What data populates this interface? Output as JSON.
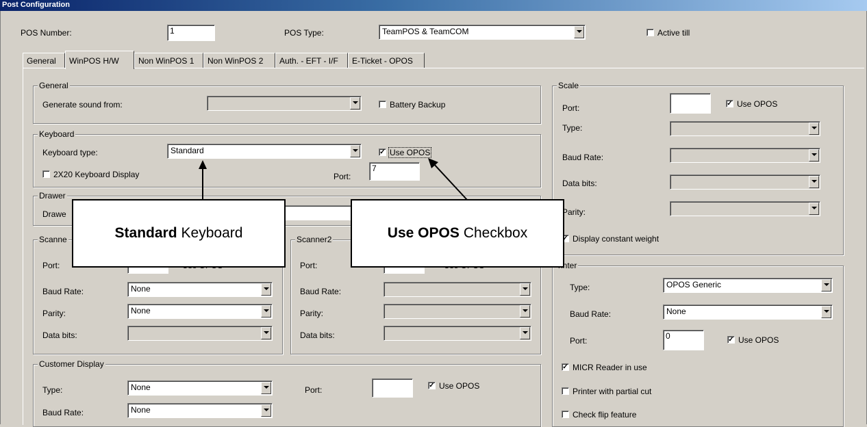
{
  "window": {
    "title": "Post Configuration"
  },
  "header": {
    "pos_number_label": "POS Number:",
    "pos_number_value": "1",
    "pos_type_label": "POS Type:",
    "pos_type_value": "TeamPOS & TeamCOM",
    "active_till_label": "Active till",
    "active_till_checked": false
  },
  "tabs": [
    {
      "label": "General"
    },
    {
      "label": "WinPOS H/W"
    },
    {
      "label": "Non WinPOS 1"
    },
    {
      "label": "Non WinPOS 2"
    },
    {
      "label": "Auth. - EFT - I/F"
    },
    {
      "label": "E-Ticket - OPOS"
    }
  ],
  "active_tab": "WinPOS H/W",
  "general": {
    "title": "General",
    "sound_label": "Generate sound from:",
    "sound_value": "",
    "battery_backup_label": "Battery Backup",
    "battery_backup_checked": false
  },
  "keyboard": {
    "title": "Keyboard",
    "type_label": "Keyboard type:",
    "type_value": "Standard",
    "use_opos_label": "Use OPOS",
    "use_opos_checked": true,
    "display_label": "2X20 Keyboard Display",
    "display_checked": false,
    "port_label": "Port:",
    "port_value": "7"
  },
  "drawer": {
    "title": "Drawer",
    "label_partial": "Drawe"
  },
  "scanner1": {
    "title_partial": "Scanne",
    "port_label": "Port:",
    "use_opos_partial": "Use OPOS",
    "baud_label": "Baud Rate:",
    "baud_value": "None",
    "parity_label": "Parity:",
    "parity_value": "None",
    "databits_label": "Data bits:",
    "databits_value": ""
  },
  "scanner2": {
    "title": "Scanner2",
    "port_label": "Port:",
    "use_opos_partial": "Use OPOS",
    "baud_label": "Baud Rate:",
    "parity_label": "Parity:",
    "databits_label": "Data bits:"
  },
  "customer_display": {
    "title": "Customer Display",
    "type_label": "Type:",
    "type_value": "None",
    "port_label": "Port:",
    "port_value": "",
    "use_opos_label": "Use OPOS",
    "use_opos_checked": true,
    "baud_label": "Baud Rate:",
    "baud_value": "None"
  },
  "scale": {
    "title": "Scale",
    "port_label": "Port:",
    "port_value": "",
    "use_opos_label": "Use OPOS",
    "use_opos_checked": true,
    "type_label": "Type:",
    "baud_label": "Baud Rate:",
    "databits_label": "Data bits:",
    "parity_label": "Parity:",
    "const_weight_label": "Display constant weight",
    "const_weight_checked": true
  },
  "printer": {
    "title_partial": "rinter",
    "type_label": "Type:",
    "type_value": "OPOS Generic",
    "baud_label": "Baud Rate:",
    "baud_value": "None",
    "port_label": "Port:",
    "port_value": "0",
    "use_opos_label": "Use OPOS",
    "use_opos_checked": true,
    "micr_label": "MICR Reader in use",
    "micr_checked": true,
    "partial_cut_label": "Printer with partial cut",
    "partial_cut_checked": false,
    "check_flip_label": "Check flip feature",
    "check_flip_checked": false
  },
  "callouts": {
    "keyboard_bold": "Standard",
    "keyboard_rest": "Keyboard",
    "opos_bold": "Use OPOS",
    "opos_rest": "Checkbox"
  }
}
